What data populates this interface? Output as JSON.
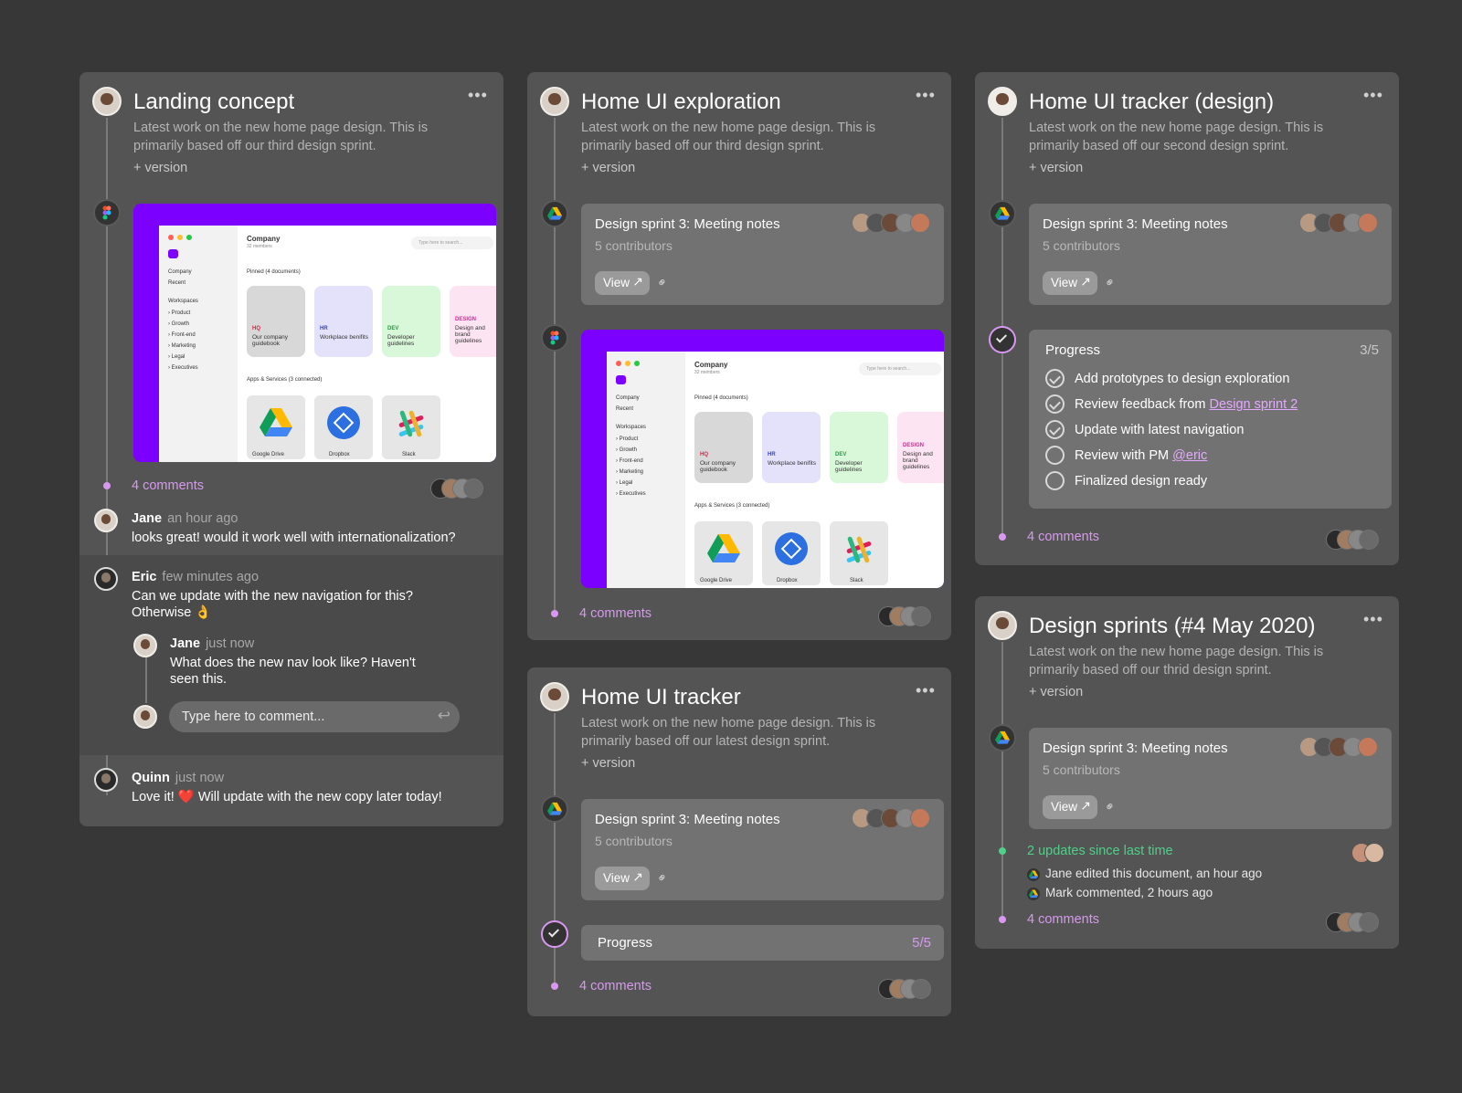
{
  "card1": {
    "title": "Landing concept",
    "desc1": "Latest work on the new home page design. This is",
    "desc2": "primarily based off our third design sprint.",
    "version": "+ version",
    "comments": "4 comments",
    "thread": [
      {
        "name": "Jane",
        "time": "an hour ago",
        "text": "looks great! would it work well with internationalization?"
      },
      {
        "name": "Eric",
        "time": "few minutes ago",
        "text1": "Can we update with the new navigation for this?",
        "text2": "Otherwise 👌"
      },
      {
        "name": "Jane",
        "time": "just now",
        "text1": "What does the new nav look like? Haven't",
        "text2": "seen this."
      },
      {
        "name": "Quinn",
        "time": "just now",
        "text": "Love it! ❤️ Will update with the new copy later today!"
      }
    ],
    "reply_placeholder": "Type here to comment..."
  },
  "preview": {
    "company": "Company",
    "members": "32 members",
    "search": "Type here to search...",
    "sidebar": [
      "Company",
      "Recent",
      "Workspaces",
      "› Product",
      "› Growth",
      "› Front-end",
      "› Marketing",
      "› Legal",
      "› Executives"
    ],
    "pinned": "Pinned (4 documents)",
    "tiles": [
      {
        "tag": "HQ",
        "text": "Our company guidebook",
        "color": "#d8d8d8",
        "tagcolor": "#e02040"
      },
      {
        "tag": "HR",
        "text": "Workplace benifits",
        "color": "#e4e2fb",
        "tagcolor": "#3040e0"
      },
      {
        "tag": "DEV",
        "text": "Developer guidelines",
        "color": "#d9f7d9",
        "tagcolor": "#20a040"
      },
      {
        "tag": "DESIGN",
        "text": "Design and brand guidelines",
        "color": "#fde4f3",
        "tagcolor": "#e020a0"
      }
    ],
    "apps_label": "Apps & Services (3 connected)",
    "apps": [
      "Google Drive",
      "Dropbox",
      "Slack"
    ]
  },
  "card2": {
    "title": "Home UI exploration",
    "desc1": "Latest work on the new home page design. This is",
    "desc2": "primarily based off our third design sprint.",
    "version": "+ version",
    "doc_title": "Design sprint 3: Meeting notes",
    "doc_sub": "5 contributors",
    "view": "View",
    "comments": "4 comments"
  },
  "card3": {
    "title": "Home UI tracker (design)",
    "desc1": "Latest work on the new home page design. This is",
    "desc2": "primarily based off our second design sprint.",
    "version": "+ version",
    "doc_title": "Design sprint 3: Meeting notes",
    "doc_sub": "5 contributors",
    "view": "View",
    "progress_label": "Progress",
    "progress_count": "3/5",
    "tasks": [
      {
        "text": "Add prototypes to design exploration",
        "done": true
      },
      {
        "text": "Review feedback from ",
        "link": "Design sprint 2",
        "done": true
      },
      {
        "text": "Update with latest navigation",
        "done": true
      },
      {
        "text": "Review with PM ",
        "link": "@eric",
        "done": false
      },
      {
        "text": "Finalized design ready",
        "done": false
      }
    ],
    "comments": "4 comments"
  },
  "card4": {
    "title": "Home UI tracker",
    "desc1": "Latest work on the new home page design. This is",
    "desc2": "primarily based off our latest design sprint.",
    "version": "+ version",
    "doc_title": "Design sprint 3: Meeting notes",
    "doc_sub": "5 contributors",
    "view": "View",
    "progress_label": "Progress",
    "progress_count": "5/5",
    "comments": "4 comments"
  },
  "card5": {
    "title": "Design sprints (#4 May 2020)",
    "desc1": "Latest work on the new home page design. This is",
    "desc2": "primarily based off our thrid design sprint.",
    "version": "+ version",
    "doc_title": "Design sprint 3: Meeting notes",
    "doc_sub": "5 contributors",
    "view": "View",
    "updates": "2 updates since last time",
    "update_items": [
      "Jane edited this document, an hour ago",
      "Mark commented, 2 hours ago"
    ],
    "comments": "4 comments"
  },
  "colors": {
    "accent": "#d898f0",
    "green": "#4fcf8a",
    "purple": "#7b00ff",
    "bg": "#373737",
    "card": "#545454"
  },
  "icons": [
    "figma-icon",
    "google-drive-icon",
    "check-circle-icon",
    "more-icon",
    "link-icon",
    "arrow-up-right-icon",
    "reply-icon"
  ]
}
